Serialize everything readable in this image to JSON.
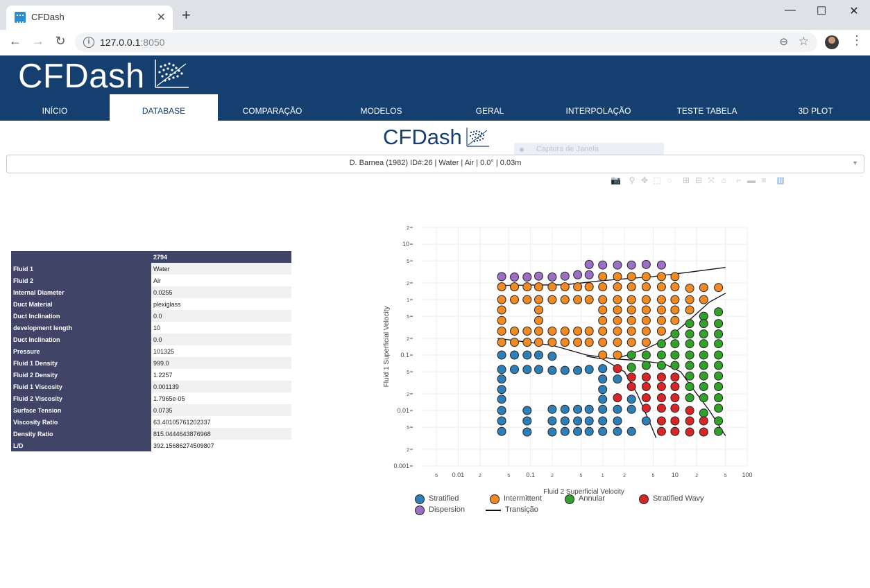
{
  "browser": {
    "tab_title": "CFDash",
    "new_tab": "+",
    "url_host": "127.0.0.1",
    "url_port": ":8050",
    "controls": {
      "minimize": "—",
      "maximize": "☐",
      "close": "✕"
    }
  },
  "app": {
    "brand": "CFDash",
    "brand_color": "#153f6e",
    "nav": [
      {
        "label": "INÍCIO",
        "active": false
      },
      {
        "label": "DATABASE",
        "active": true
      },
      {
        "label": "COMPARAÇÃO",
        "active": false
      },
      {
        "label": "MODELOS",
        "active": false
      },
      {
        "label": "GERAL",
        "active": false
      },
      {
        "label": "INTERPOLAÇÃO",
        "active": false
      },
      {
        "label": "TESTE TABELA",
        "active": false
      },
      {
        "label": "3D PLOT",
        "active": false
      }
    ]
  },
  "page": {
    "logo": "CFDash",
    "overlay_hint": "Captura de Janela",
    "dropdown_value": "D. Barnea (1982) ID#:26 | Water | Air | 0.0° | 0.03m"
  },
  "table": {
    "header": "2794",
    "rows": [
      {
        "key": "Fluid 1",
        "value": "Water"
      },
      {
        "key": "Fluid 2",
        "value": "Air"
      },
      {
        "key": "Internal Diameter",
        "value": "0.0255"
      },
      {
        "key": "Duct Material",
        "value": "plexiglass"
      },
      {
        "key": "Duct Inclination",
        "value": "0.0"
      },
      {
        "key": "development length",
        "value": "10"
      },
      {
        "key": "Duct Inclination",
        "value": "0.0"
      },
      {
        "key": "Pressure",
        "value": "101325"
      },
      {
        "key": "Fluid 1 Density",
        "value": "999.0"
      },
      {
        "key": "Fluid 2 Density",
        "value": "1.2257"
      },
      {
        "key": "Fluid 1 Viscosity",
        "value": "0.001139"
      },
      {
        "key": "Fluid 2 Viscosity",
        "value": "1.7965e-05"
      },
      {
        "key": "Surface Tension",
        "value": "0.0735"
      },
      {
        "key": "Viscosity Ratio",
        "value": "63.40105761202337"
      },
      {
        "key": "Density Ratio",
        "value": "815.0444643876968"
      },
      {
        "key": "L/D",
        "value": "392.15686274509807"
      }
    ]
  },
  "chart_data": {
    "type": "scatter",
    "xlabel": "Fluid 2 Superficial Velocity",
    "ylabel": "Fluid 1 Superficial Velocity",
    "xscale": "log",
    "yscale": "log",
    "xlim": [
      0.003,
      100
    ],
    "ylim": [
      0.001,
      20
    ],
    "grid": true,
    "legend_position": "bottom",
    "x_ticks": [
      {
        "v": 0.005,
        "t": "5"
      },
      {
        "v": 0.01,
        "t": "0.01"
      },
      {
        "v": 0.02,
        "t": "2"
      },
      {
        "v": 0.05,
        "t": "5"
      },
      {
        "v": 0.1,
        "t": "0.1"
      },
      {
        "v": 0.2,
        "t": "2"
      },
      {
        "v": 0.5,
        "t": "5"
      },
      {
        "v": 1,
        "t": "1"
      },
      {
        "v": 2,
        "t": "2"
      },
      {
        "v": 5,
        "t": "5"
      },
      {
        "v": 10,
        "t": "10"
      },
      {
        "v": 20,
        "t": "2"
      },
      {
        "v": 50,
        "t": "5"
      },
      {
        "v": 100,
        "t": "100"
      }
    ],
    "y_ticks": [
      {
        "v": 0.001,
        "t": "0.001"
      },
      {
        "v": 0.002,
        "t": "2"
      },
      {
        "v": 0.005,
        "t": "5"
      },
      {
        "v": 0.01,
        "t": "0.01"
      },
      {
        "v": 0.02,
        "t": "2"
      },
      {
        "v": 0.05,
        "t": "5"
      },
      {
        "v": 0.1,
        "t": "0.1"
      },
      {
        "v": 0.2,
        "t": "2"
      },
      {
        "v": 0.5,
        "t": "5"
      },
      {
        "v": 1,
        "t": "1"
      },
      {
        "v": 2,
        "t": "2"
      },
      {
        "v": 5,
        "t": "5"
      },
      {
        "v": 10,
        "t": "10"
      },
      {
        "v": 20,
        "t": "2"
      }
    ],
    "series": [
      {
        "name": "Stratified",
        "color": "#2e7fb8",
        "points": [
          [
            0.04,
            0.1
          ],
          [
            0.06,
            0.1
          ],
          [
            0.09,
            0.1
          ],
          [
            0.13,
            0.1
          ],
          [
            0.2,
            0.095
          ],
          [
            0.04,
            0.055
          ],
          [
            0.06,
            0.055
          ],
          [
            0.09,
            0.055
          ],
          [
            0.13,
            0.055
          ],
          [
            0.2,
            0.053
          ],
          [
            0.3,
            0.053
          ],
          [
            0.45,
            0.053
          ],
          [
            0.65,
            0.055
          ],
          [
            1.0,
            0.057
          ],
          [
            0.04,
            0.037
          ],
          [
            0.04,
            0.024
          ],
          [
            0.04,
            0.016
          ],
          [
            0.04,
            0.01
          ],
          [
            0.04,
            0.0065
          ],
          [
            0.04,
            0.0042
          ],
          [
            1.0,
            0.037
          ],
          [
            1.0,
            0.024
          ],
          [
            1.0,
            0.016
          ],
          [
            1.0,
            0.0105
          ],
          [
            1.0,
            0.0065
          ],
          [
            1.0,
            0.0042
          ],
          [
            1.6,
            0.037
          ],
          [
            2.5,
            0.016
          ],
          [
            2.5,
            0.0105
          ],
          [
            4,
            0.0065
          ],
          [
            0.09,
            0.01
          ],
          [
            0.09,
            0.0065
          ],
          [
            0.09,
            0.0041
          ],
          [
            0.2,
            0.0105
          ],
          [
            0.2,
            0.0065
          ],
          [
            0.2,
            0.0041
          ],
          [
            0.3,
            0.0105
          ],
          [
            0.3,
            0.0065
          ],
          [
            0.3,
            0.0042
          ],
          [
            0.45,
            0.0105
          ],
          [
            0.45,
            0.0065
          ],
          [
            0.45,
            0.0042
          ],
          [
            0.65,
            0.0105
          ],
          [
            0.65,
            0.0065
          ],
          [
            0.65,
            0.0042
          ],
          [
            1.6,
            0.0065
          ],
          [
            1.6,
            0.0042
          ],
          [
            2.5,
            0.0042
          ],
          [
            1.6,
            0.0105
          ]
        ]
      },
      {
        "name": "Intermittent",
        "color": "#f08a24",
        "points": [
          [
            0.04,
            1.7
          ],
          [
            0.06,
            1.7
          ],
          [
            0.09,
            1.7
          ],
          [
            0.13,
            1.7
          ],
          [
            0.2,
            1.7
          ],
          [
            0.3,
            1.7
          ],
          [
            0.45,
            1.7
          ],
          [
            0.65,
            1.7
          ],
          [
            1.0,
            1.7
          ],
          [
            1.6,
            1.7
          ],
          [
            2.5,
            1.7
          ],
          [
            4,
            1.7
          ],
          [
            6.5,
            1.7
          ],
          [
            10,
            1.7
          ],
          [
            16,
            1.6
          ],
          [
            25,
            1.65
          ],
          [
            40,
            1.65
          ],
          [
            1.0,
            2.6
          ],
          [
            1.6,
            2.6
          ],
          [
            2.5,
            2.6
          ],
          [
            4,
            2.6
          ],
          [
            6.5,
            2.6
          ],
          [
            10,
            2.6
          ],
          [
            0.04,
            1.0
          ],
          [
            0.06,
            1.0
          ],
          [
            0.09,
            1.0
          ],
          [
            0.13,
            1.0
          ],
          [
            0.2,
            1.0
          ],
          [
            0.3,
            1.0
          ],
          [
            0.45,
            1.0
          ],
          [
            0.65,
            1.0
          ],
          [
            1.0,
            1.0
          ],
          [
            1.6,
            1.0
          ],
          [
            2.5,
            1.0
          ],
          [
            4,
            1.0
          ],
          [
            6.5,
            1.0
          ],
          [
            10,
            1.0
          ],
          [
            16,
            1.0
          ],
          [
            25,
            1.0
          ],
          [
            0.04,
            0.65
          ],
          [
            0.13,
            0.65
          ],
          [
            1.0,
            0.65
          ],
          [
            1.6,
            0.65
          ],
          [
            2.5,
            0.65
          ],
          [
            4,
            0.65
          ],
          [
            6.5,
            0.65
          ],
          [
            10,
            0.65
          ],
          [
            16,
            0.65
          ],
          [
            0.04,
            0.42
          ],
          [
            0.13,
            0.42
          ],
          [
            1.0,
            0.42
          ],
          [
            1.6,
            0.42
          ],
          [
            2.5,
            0.42
          ],
          [
            4,
            0.42
          ],
          [
            6.5,
            0.42
          ],
          [
            10,
            0.42
          ],
          [
            0.04,
            0.27
          ],
          [
            0.06,
            0.27
          ],
          [
            0.09,
            0.27
          ],
          [
            0.13,
            0.27
          ],
          [
            0.2,
            0.27
          ],
          [
            0.3,
            0.27
          ],
          [
            0.45,
            0.27
          ],
          [
            0.65,
            0.27
          ],
          [
            1.0,
            0.27
          ],
          [
            1.6,
            0.27
          ],
          [
            2.5,
            0.27
          ],
          [
            4,
            0.27
          ],
          [
            6.5,
            0.27
          ],
          [
            0.04,
            0.17
          ],
          [
            0.06,
            0.17
          ],
          [
            0.09,
            0.17
          ],
          [
            0.13,
            0.17
          ],
          [
            0.2,
            0.17
          ],
          [
            0.3,
            0.17
          ],
          [
            0.45,
            0.17
          ],
          [
            0.65,
            0.17
          ],
          [
            1.0,
            0.17
          ],
          [
            1.6,
            0.17
          ],
          [
            2.5,
            0.17
          ],
          [
            4,
            0.17
          ],
          [
            1.0,
            0.1
          ],
          [
            1.6,
            0.1
          ]
        ]
      },
      {
        "name": "Annular",
        "color": "#33a02c",
        "points": [
          [
            40,
            0.6
          ],
          [
            25,
            0.5
          ],
          [
            40,
            0.37
          ],
          [
            25,
            0.37
          ],
          [
            16,
            0.37
          ],
          [
            40,
            0.24
          ],
          [
            25,
            0.24
          ],
          [
            16,
            0.24
          ],
          [
            10,
            0.24
          ],
          [
            40,
            0.16
          ],
          [
            25,
            0.16
          ],
          [
            16,
            0.16
          ],
          [
            10,
            0.16
          ],
          [
            6.5,
            0.16
          ],
          [
            40,
            0.1
          ],
          [
            25,
            0.1
          ],
          [
            16,
            0.1
          ],
          [
            10,
            0.1
          ],
          [
            6.5,
            0.1
          ],
          [
            4,
            0.1
          ],
          [
            2.5,
            0.1
          ],
          [
            40,
            0.065
          ],
          [
            25,
            0.065
          ],
          [
            16,
            0.065
          ],
          [
            10,
            0.065
          ],
          [
            6.5,
            0.065
          ],
          [
            4,
            0.065
          ],
          [
            2.5,
            0.06
          ],
          [
            40,
            0.042
          ],
          [
            25,
            0.042
          ],
          [
            16,
            0.042
          ],
          [
            40,
            0.027
          ],
          [
            25,
            0.027
          ],
          [
            16,
            0.027
          ],
          [
            40,
            0.017
          ],
          [
            25,
            0.017
          ],
          [
            16,
            0.017
          ],
          [
            40,
            0.011
          ],
          [
            25,
            0.009
          ],
          [
            40,
            0.0065
          ],
          [
            40,
            0.0042
          ]
        ]
      },
      {
        "name": "Stratified Wavy",
        "color": "#d62728",
        "points": [
          [
            1.6,
            0.057
          ],
          [
            2.5,
            0.04
          ],
          [
            4,
            0.04
          ],
          [
            6.5,
            0.04
          ],
          [
            10,
            0.04
          ],
          [
            2.5,
            0.027
          ],
          [
            4,
            0.027
          ],
          [
            6.5,
            0.027
          ],
          [
            10,
            0.027
          ],
          [
            4,
            0.017
          ],
          [
            6.5,
            0.017
          ],
          [
            10,
            0.017
          ],
          [
            1.6,
            0.017
          ],
          [
            4,
            0.011
          ],
          [
            6.5,
            0.011
          ],
          [
            10,
            0.011
          ],
          [
            16,
            0.01
          ],
          [
            6.5,
            0.0065
          ],
          [
            10,
            0.0065
          ],
          [
            16,
            0.0065
          ],
          [
            25,
            0.0065
          ],
          [
            6.5,
            0.0042
          ],
          [
            10,
            0.0042
          ],
          [
            16,
            0.0041
          ],
          [
            25,
            0.0041
          ]
        ]
      },
      {
        "name": "Dispersion",
        "color": "#9a6fc4",
        "points": [
          [
            0.04,
            2.6
          ],
          [
            0.06,
            2.55
          ],
          [
            0.09,
            2.55
          ],
          [
            0.13,
            2.65
          ],
          [
            0.2,
            2.55
          ],
          [
            0.3,
            2.65
          ],
          [
            0.45,
            2.8
          ],
          [
            0.65,
            4.3
          ],
          [
            0.65,
            2.8
          ],
          [
            1.0,
            4.2
          ],
          [
            1.6,
            4.2
          ],
          [
            2.5,
            4.2
          ],
          [
            4,
            4.3
          ],
          [
            6.5,
            4.2
          ]
        ]
      }
    ],
    "transition_name": "Transição",
    "transitions": [
      [
        [
          0.035,
          1.8
        ],
        [
          0.3,
          1.85
        ],
        [
          1.0,
          2.2
        ],
        [
          5,
          2.6
        ],
        [
          15,
          3.1
        ],
        [
          50,
          3.8
        ]
      ],
      [
        [
          0.035,
          0.2
        ],
        [
          0.2,
          0.15
        ],
        [
          0.6,
          0.1
        ],
        [
          1.5,
          0.085
        ],
        [
          3,
          0.08
        ],
        [
          7,
          0.07
        ],
        [
          12,
          0.05
        ],
        [
          20,
          0.02
        ],
        [
          30,
          0.01
        ],
        [
          50,
          0.0035
        ]
      ],
      [
        [
          0.6,
          0.095
        ],
        [
          1.0,
          0.085
        ],
        [
          2,
          0.05
        ],
        [
          3,
          0.02
        ],
        [
          4.5,
          0.006
        ],
        [
          5.5,
          0.0032
        ]
      ],
      [
        [
          1.5,
          0.085
        ],
        [
          4,
          0.13
        ],
        [
          8,
          0.2
        ],
        [
          15,
          0.4
        ],
        [
          30,
          0.9
        ],
        [
          50,
          1.3
        ]
      ]
    ]
  }
}
